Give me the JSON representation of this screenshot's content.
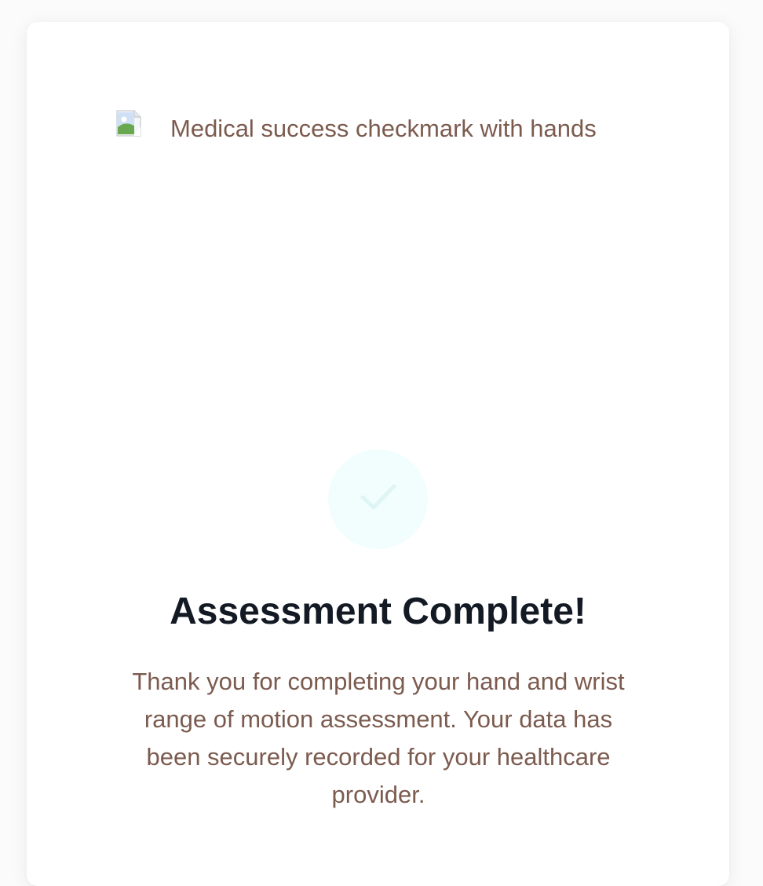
{
  "hero_image": {
    "alt_text": "Medical success checkmark with hands",
    "icon": "broken-image-icon"
  },
  "success_badge": {
    "icon": "checkmark-icon",
    "background": "#f2fefe",
    "icon_color": "#dff5f5"
  },
  "content": {
    "title": "Assessment Complete!",
    "message": "Thank you for completing your hand and wrist range of motion assessment. Your data has been securely recorded for your healthcare provider."
  },
  "colors": {
    "title": "#141a24",
    "body_text": "#7c5b4f",
    "card_background": "#ffffff",
    "page_background": "#fbfbfb"
  }
}
